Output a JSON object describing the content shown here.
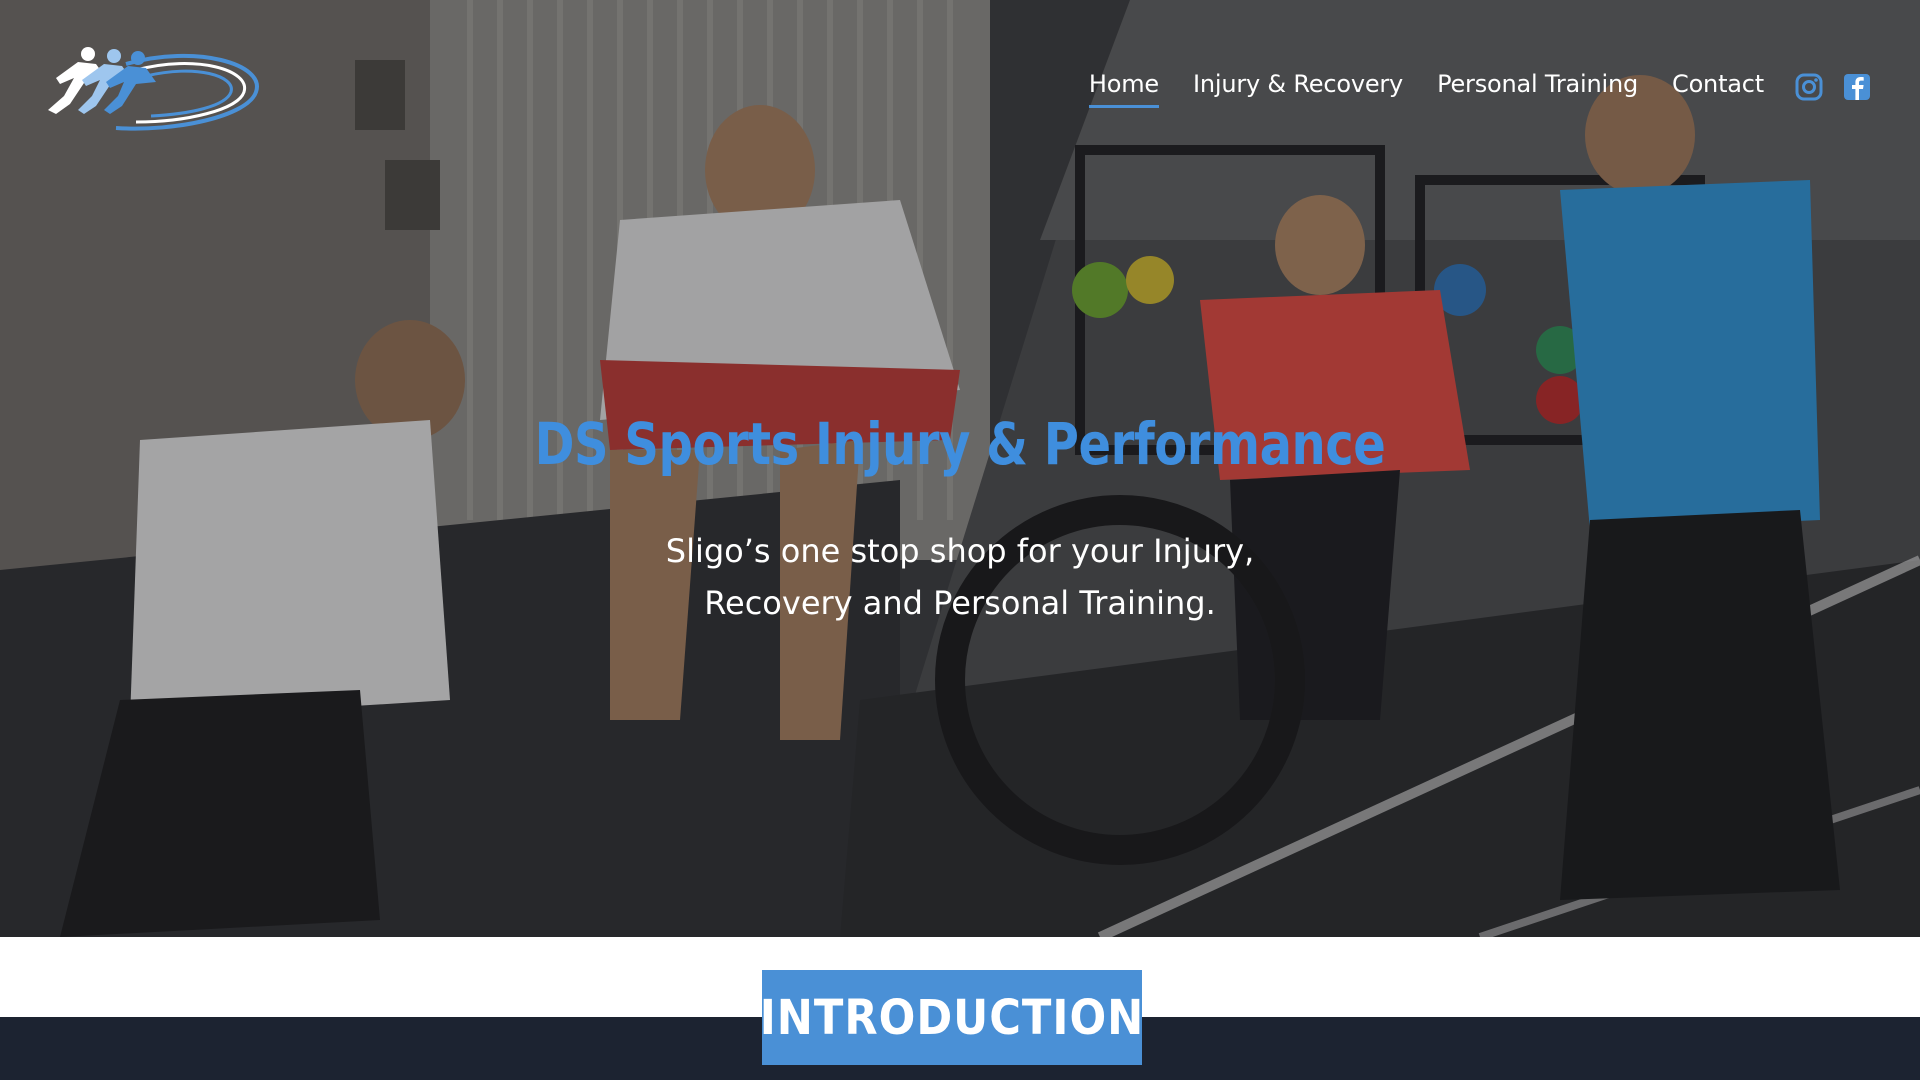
{
  "brand": {
    "logo_icon": "sprinters-logo-icon",
    "accent_color": "#4a90d6",
    "title_color": "#3f8ede"
  },
  "nav": {
    "items": [
      {
        "label": "Home",
        "active": true
      },
      {
        "label": "Injury & Recovery",
        "active": false
      },
      {
        "label": "Personal Training",
        "active": false
      },
      {
        "label": "Contact",
        "active": false
      }
    ],
    "social": [
      {
        "icon": "instagram-icon"
      },
      {
        "icon": "facebook-icon"
      }
    ]
  },
  "hero": {
    "title": "DS Sports Injury & Performance",
    "subtitle_line1": "Sligo’s one stop shop for your Injury,",
    "subtitle_line2": "Recovery and Personal Training."
  },
  "intro": {
    "heading": "INTRODUCTION",
    "bar_color": "#1c2331"
  }
}
